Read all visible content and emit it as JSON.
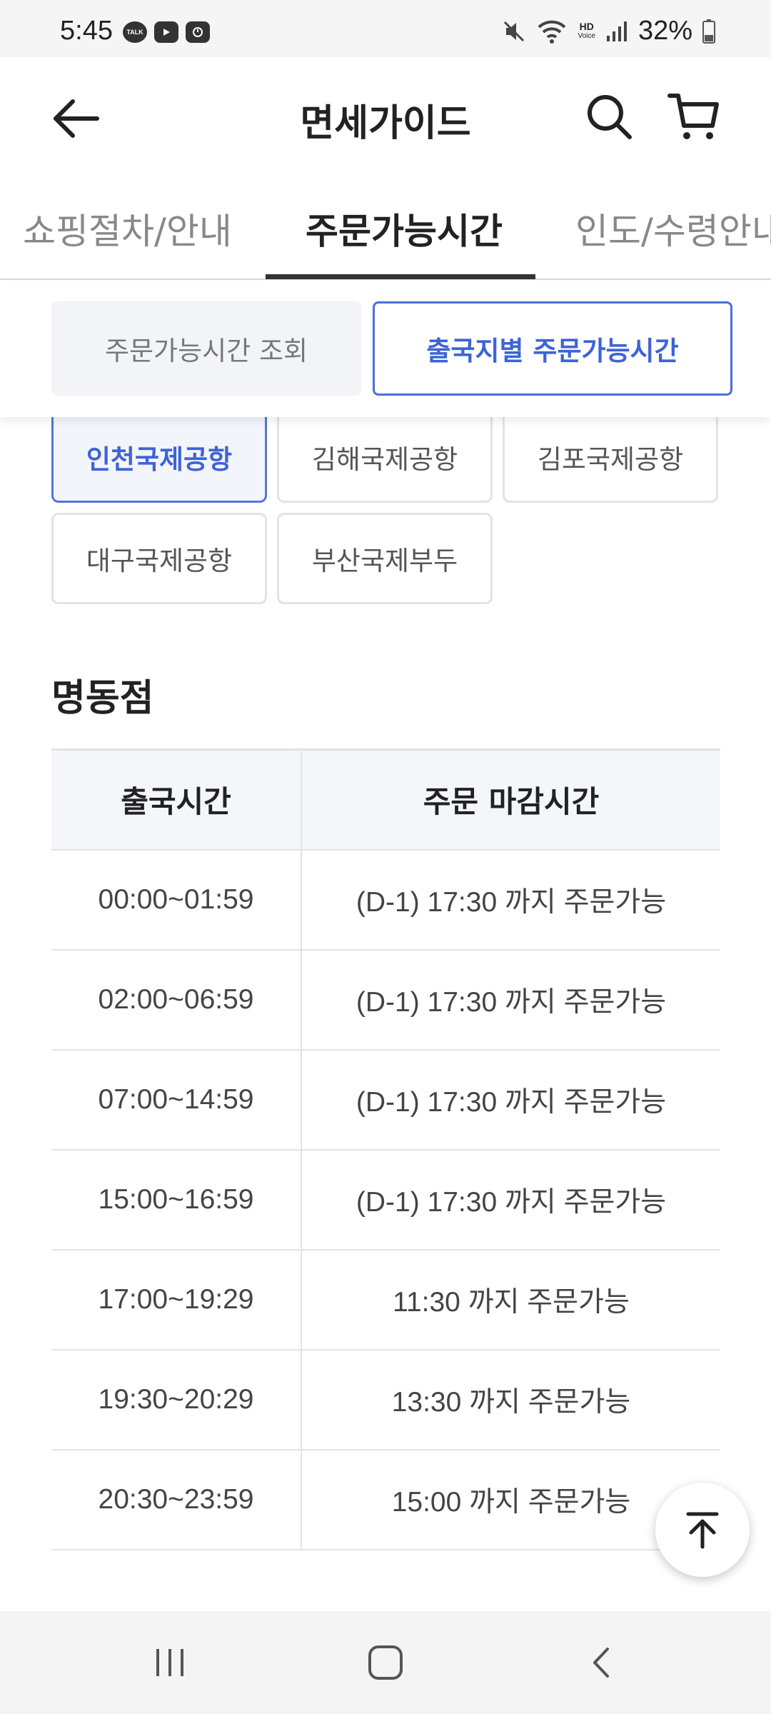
{
  "status_bar": {
    "time": "5:45",
    "icons": [
      "talk-icon",
      "youtube-icon",
      "clock-app-icon",
      "mute-icon",
      "wifi-icon",
      "hd-voice-icon",
      "signal-icon",
      "battery-icon"
    ],
    "talk_badge": "TALK",
    "hd_label": "HD",
    "voice_label": "Voice",
    "battery": "32%"
  },
  "header": {
    "title": "면세가이드"
  },
  "tabs": [
    {
      "label": "쇼핑절차/안내"
    },
    {
      "label": "주문가능시간",
      "active": true
    },
    {
      "label": "인도/수령안내"
    }
  ],
  "sub_tabs": [
    {
      "label": "주문가능시간 조회"
    },
    {
      "label": "출국지별 주문가능시간",
      "active": true
    }
  ],
  "airports": [
    {
      "label": "인천국제공항",
      "active": true
    },
    {
      "label": "김해국제공항"
    },
    {
      "label": "김포국제공항"
    },
    {
      "label": "대구국제공항"
    },
    {
      "label": "부산국제부두"
    }
  ],
  "section": {
    "title": "명동점"
  },
  "table": {
    "headers": [
      "출국시간",
      "주문 마감시간"
    ],
    "rows": [
      [
        "00:00~01:59",
        "(D-1) 17:30 까지 주문가능"
      ],
      [
        "02:00~06:59",
        "(D-1) 17:30 까지 주문가능"
      ],
      [
        "07:00~14:59",
        "(D-1) 17:30 까지 주문가능"
      ],
      [
        "15:00~16:59",
        "(D-1) 17:30 까지 주문가능"
      ],
      [
        "17:00~19:29",
        "11:30 까지 주문가능"
      ],
      [
        "19:30~20:29",
        "13:30 까지 주문가능"
      ],
      [
        "20:30~23:59",
        "15:00 까지 주문가능"
      ]
    ]
  },
  "colors": {
    "accent": "#3e63d6",
    "border": "#e3e3e3",
    "header_bg": "#f5f6fa"
  }
}
